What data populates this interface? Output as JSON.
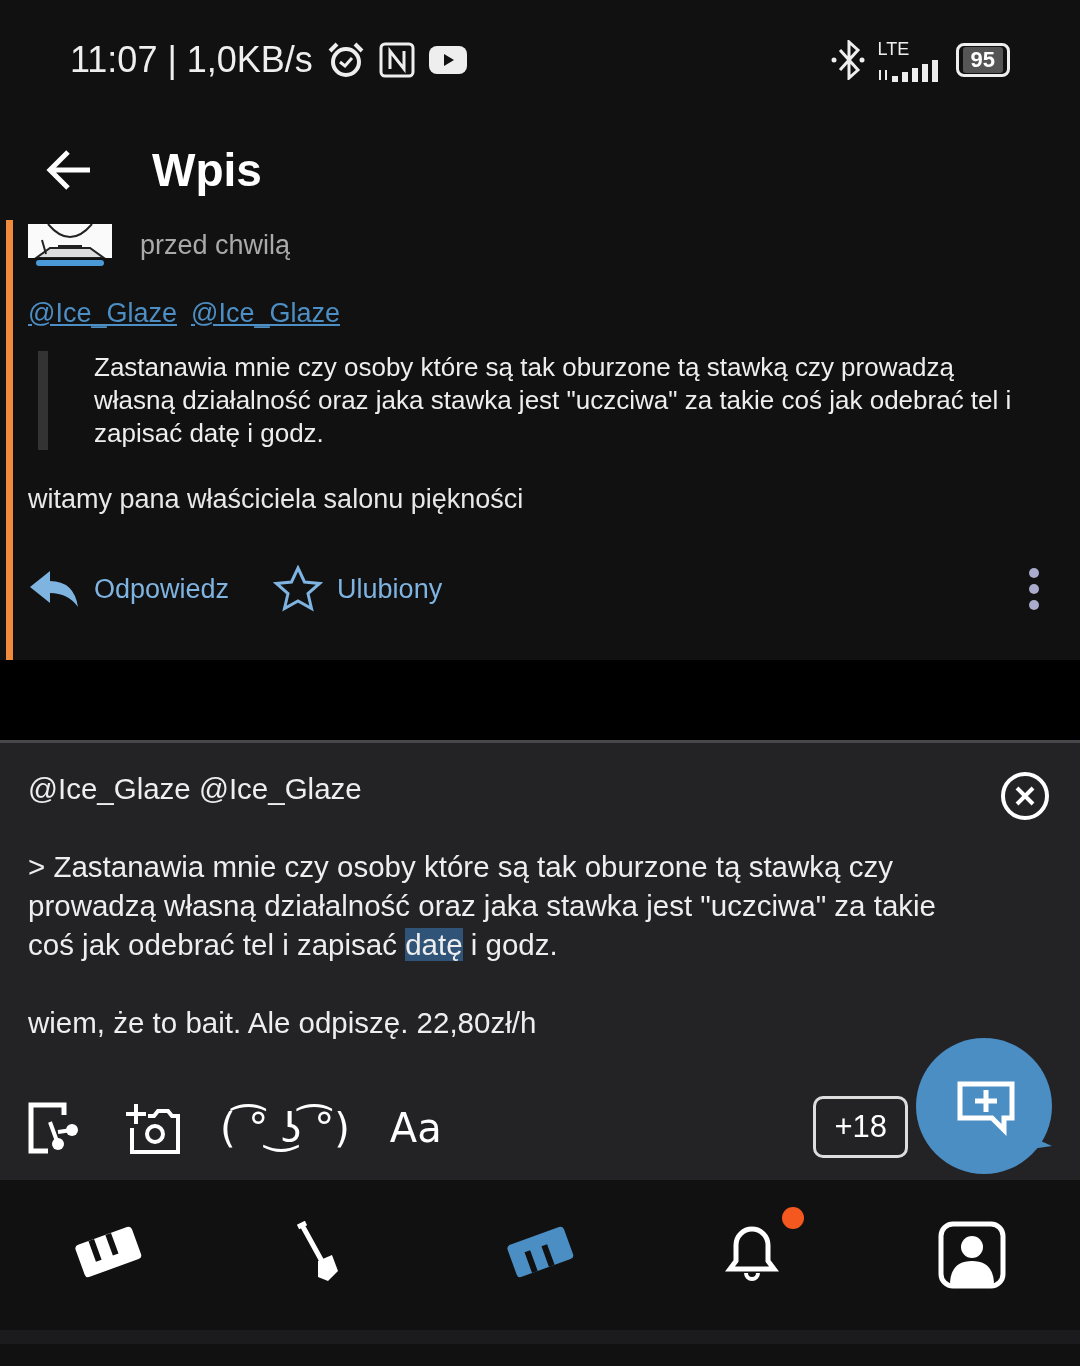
{
  "status_bar": {
    "time": "11:07 | 1,0KB/s",
    "network": "LTE",
    "battery": "95"
  },
  "app_bar": {
    "title": "Wpis"
  },
  "post": {
    "time": "przed chwilą",
    "mentions": [
      "@Ice_Glaze",
      "@Ice_Glaze"
    ],
    "quote": "Zastanawia mnie czy osoby które są tak oburzone tą stawką czy prowadzą własną działalność oraz jaka stawka jest \"uczciwa\" za takie coś jak odebrać tel i zapisać datę i godz.",
    "body": "witamy pana właściciela salonu piękności",
    "actions": [
      {
        "kind": "reply",
        "label": "Odpowiedz"
      },
      {
        "kind": "favorite",
        "label": "Ulubiony",
        "selected": false
      }
    ]
  },
  "editor": {
    "paragraphs": [
      [
        {
          "text": "@Ice_Glaze  @Ice_Glaze",
          "selected": false
        }
      ],
      [
        {
          "text": "> Zastanawia mnie czy osoby które są tak oburzone tą stawką czy prowadzą własną działalność oraz jaka stawka jest \"uczciwa\" za takie coś jak odebrać tel i zapisać ",
          "selected": false
        },
        {
          "text": "datę",
          "selected": true
        },
        {
          "text": " i godz.",
          "selected": false
        }
      ],
      [
        {
          "text": "wiem, że to bait. Ale odpiszę. 22,80zł/h",
          "selected": false
        }
      ]
    ],
    "toolbar": [
      {
        "kind": "attach"
      },
      {
        "kind": "camera"
      },
      {
        "kind": "text",
        "label": "( ͡° ͜ʖ ͡°)"
      },
      {
        "kind": "text",
        "label": "Aa"
      }
    ],
    "adult_button": "+18"
  },
  "bottom_nav": [
    {
      "kind": "wykop",
      "selected": false
    },
    {
      "kind": "shovel",
      "selected": false
    },
    {
      "kind": "mikroblog",
      "selected": true
    },
    {
      "kind": "bell",
      "selected": false,
      "badge": true
    },
    {
      "kind": "profile",
      "selected": false
    }
  ]
}
